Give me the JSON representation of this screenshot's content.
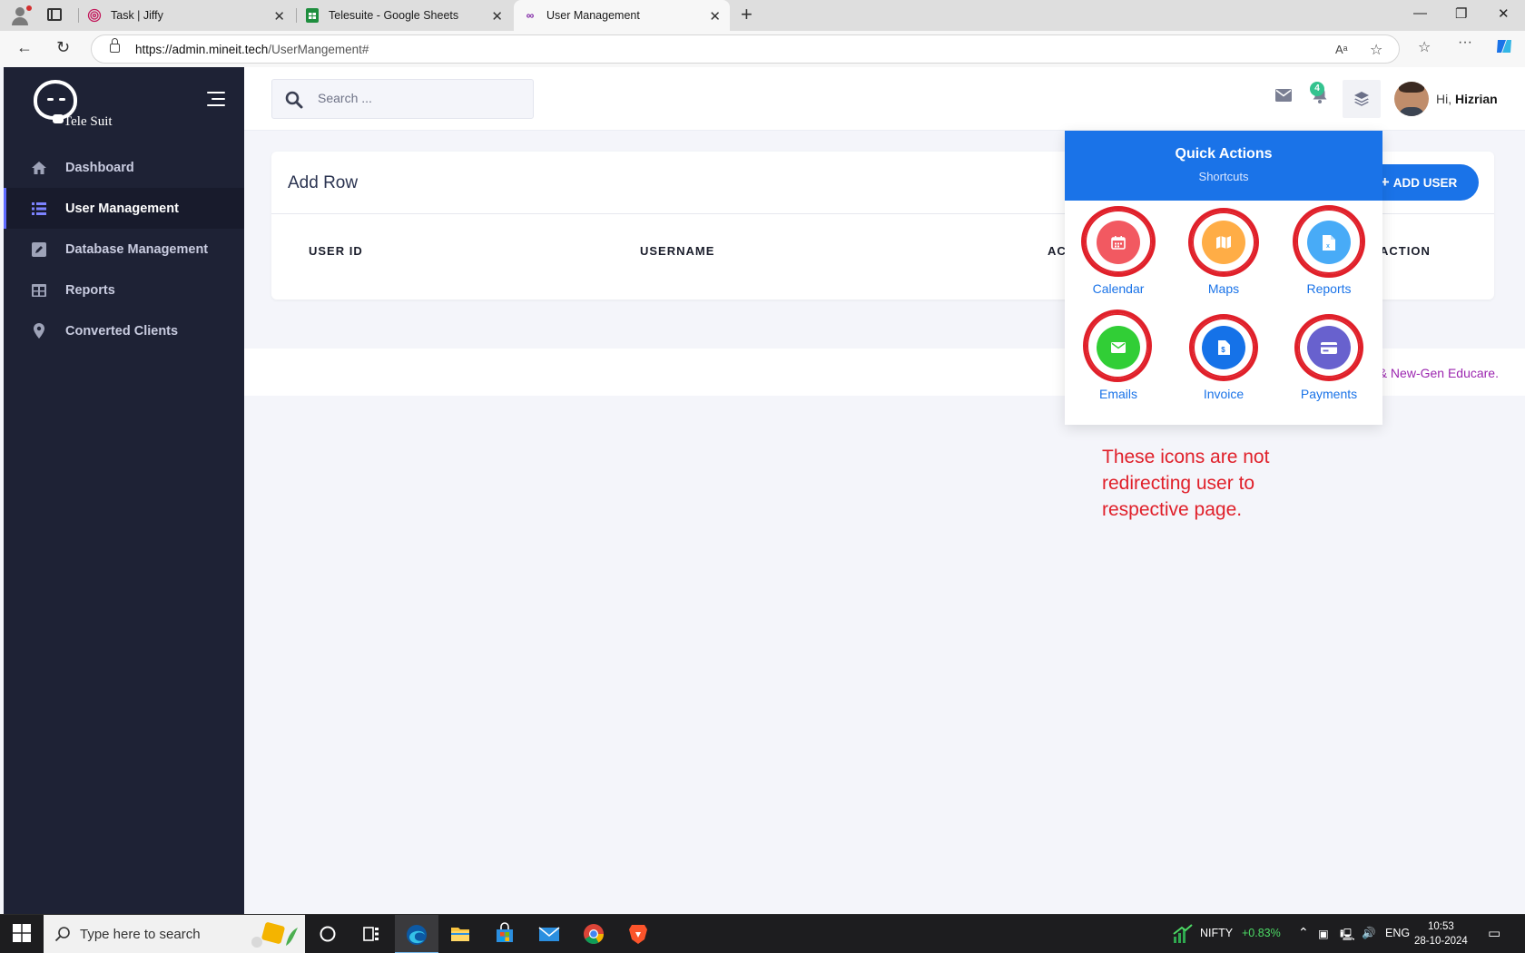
{
  "browser": {
    "tabs": [
      {
        "title": "Task | Jiffy",
        "favicon": "fingerprint-icon"
      },
      {
        "title": "Telesuite - Google Sheets",
        "favicon": "google-sheets-icon"
      },
      {
        "title": "User Management",
        "favicon": "infinity-icon"
      }
    ],
    "url_host": "https://admin.mineit.tech",
    "url_path": "/UserMangement#"
  },
  "sidebar": {
    "brand": "Tele Suit",
    "items": [
      {
        "label": "Dashboard",
        "icon": "home-icon"
      },
      {
        "label": "User Management",
        "icon": "list-icon"
      },
      {
        "label": "Database Management",
        "icon": "edit-square-icon"
      },
      {
        "label": "Reports",
        "icon": "table-icon"
      },
      {
        "label": "Converted Clients",
        "icon": "map-pin-icon"
      }
    ]
  },
  "header": {
    "search_placeholder": "Search ...",
    "notification_count": "4",
    "greeting_prefix": "Hi,",
    "user_name": "Hizrian"
  },
  "card": {
    "title": "Add Row",
    "add_user_label": "ADD USER",
    "columns": [
      "USER ID",
      "USERNAME",
      "AC",
      "ACTION"
    ]
  },
  "footer": {
    "text": "& New-Gen Educare."
  },
  "quick_actions": {
    "title": "Quick Actions",
    "subtitle": "Shortcuts",
    "items": [
      {
        "label": "Calendar",
        "icon": "calendar-icon",
        "color": "#f25961"
      },
      {
        "label": "Maps",
        "icon": "map-icon",
        "color": "#ffad46"
      },
      {
        "label": "Reports",
        "icon": "excel-file-icon",
        "color": "#48abf7"
      },
      {
        "label": "Emails",
        "icon": "envelope-icon",
        "color": "#31ce36"
      },
      {
        "label": "Invoice",
        "icon": "invoice-icon",
        "color": "#1572e8"
      },
      {
        "label": "Payments",
        "icon": "credit-card-icon",
        "color": "#6861ce"
      }
    ]
  },
  "annotation": "These icons are not redirecting user to respective page.",
  "taskbar": {
    "search_placeholder": "Type here to search",
    "ticker_name": "NIFTY",
    "ticker_change": "+0.83%",
    "language": "ENG",
    "time": "10:53",
    "date": "28-10-2024"
  },
  "colors": {
    "sidebar_bg": "#1e2235",
    "primary": "#1a73e8",
    "annotation": "#e0202a",
    "footer_link": "#9c27b0",
    "badge": "#34c38f"
  }
}
